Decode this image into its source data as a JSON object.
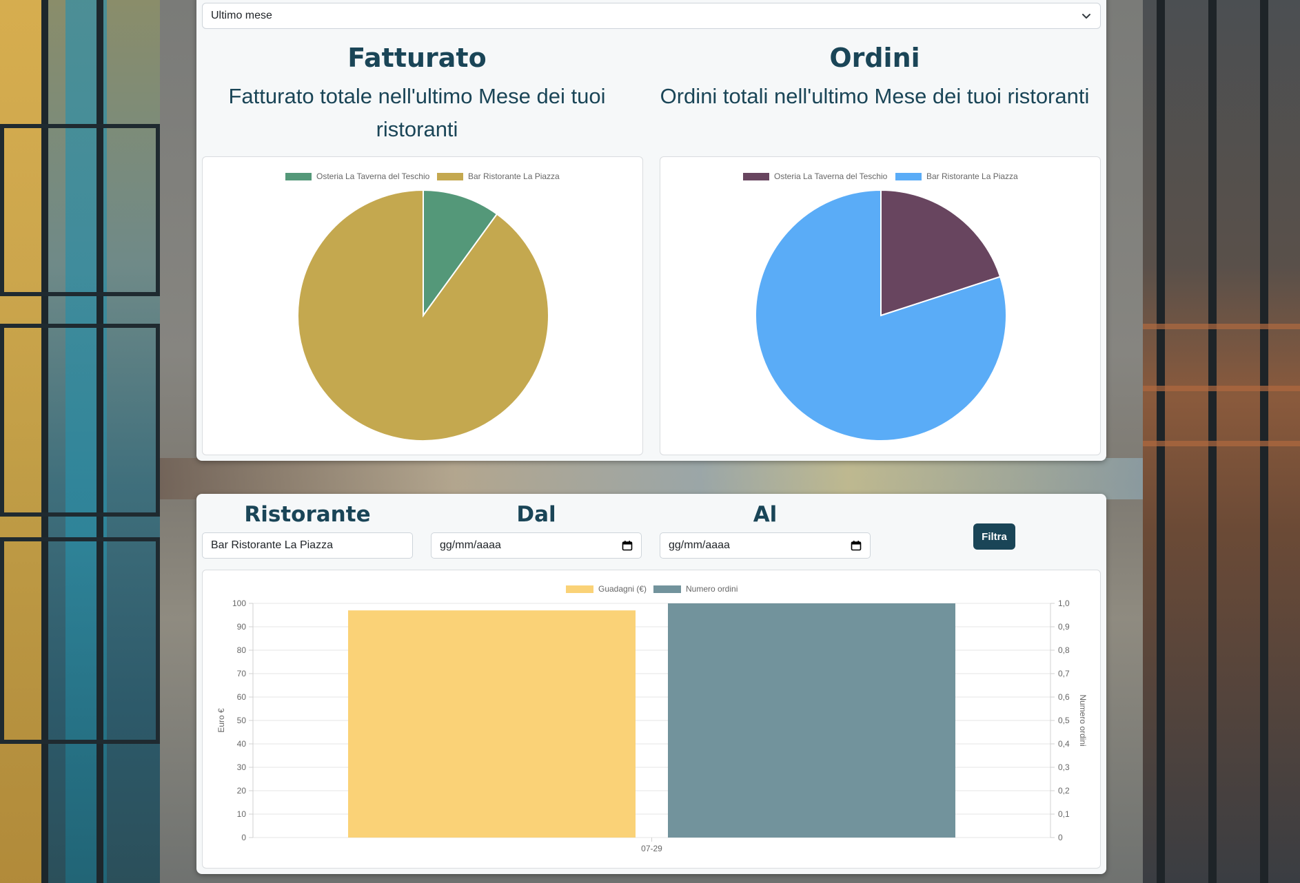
{
  "period_select": {
    "value": "Ultimo mese"
  },
  "revenue": {
    "title": "Fatturato",
    "subtitle": "Fatturato totale nell'ultimo Mese dei tuoi ristoranti"
  },
  "orders": {
    "title": "Ordini",
    "subtitle": "Ordini totali nell'ultimo Mese dei tuoi ristoranti"
  },
  "filter": {
    "restaurant_label": "Ristorante",
    "restaurant_value": "Bar Ristorante La Piazza",
    "from_label": "Dal",
    "from_placeholder": "gg/mm/aaaa",
    "to_label": "Al",
    "to_placeholder": "gg/mm/aaaa",
    "button_label": "Filtra"
  },
  "colors": {
    "brand": "#1a4557",
    "osteria_revenue": "#549879",
    "piazza_revenue": "#c4a84f",
    "osteria_orders": "#68455f",
    "piazza_orders": "#5aacf7",
    "guadagni": "#fad277",
    "numero_ordini": "#72939c"
  },
  "chart_data": [
    {
      "type": "pie",
      "labels": [
        "Osteria La Taverna del Teschio",
        "Bar Ristorante La Piazza"
      ],
      "values": [
        10,
        90
      ],
      "legend": "top"
    },
    {
      "type": "pie",
      "labels": [
        "Osteria La Taverna del Teschio",
        "Bar Ristorante La Piazza"
      ],
      "values": [
        20,
        80
      ],
      "legend": "top"
    },
    {
      "type": "bar",
      "categories": [
        "07-29"
      ],
      "series": [
        {
          "name": "Guadagni (€)",
          "values": [
            97
          ],
          "axis": "left"
        },
        {
          "name": "Numero ordini",
          "values": [
            1
          ],
          "axis": "right"
        }
      ],
      "ylabel": "Euro €",
      "y2label": "Numero ordini",
      "ylim": [
        0,
        100
      ],
      "y2lim": [
        0,
        1
      ],
      "yticks": [
        "0",
        "10",
        "20",
        "30",
        "40",
        "50",
        "60",
        "70",
        "80",
        "90",
        "100"
      ],
      "y2ticks": [
        "0",
        "0,1",
        "0,2",
        "0,3",
        "0,4",
        "0,5",
        "0,6",
        "0,7",
        "0,8",
        "0,9",
        "1,0"
      ],
      "legend": "top",
      "grid": true
    }
  ]
}
